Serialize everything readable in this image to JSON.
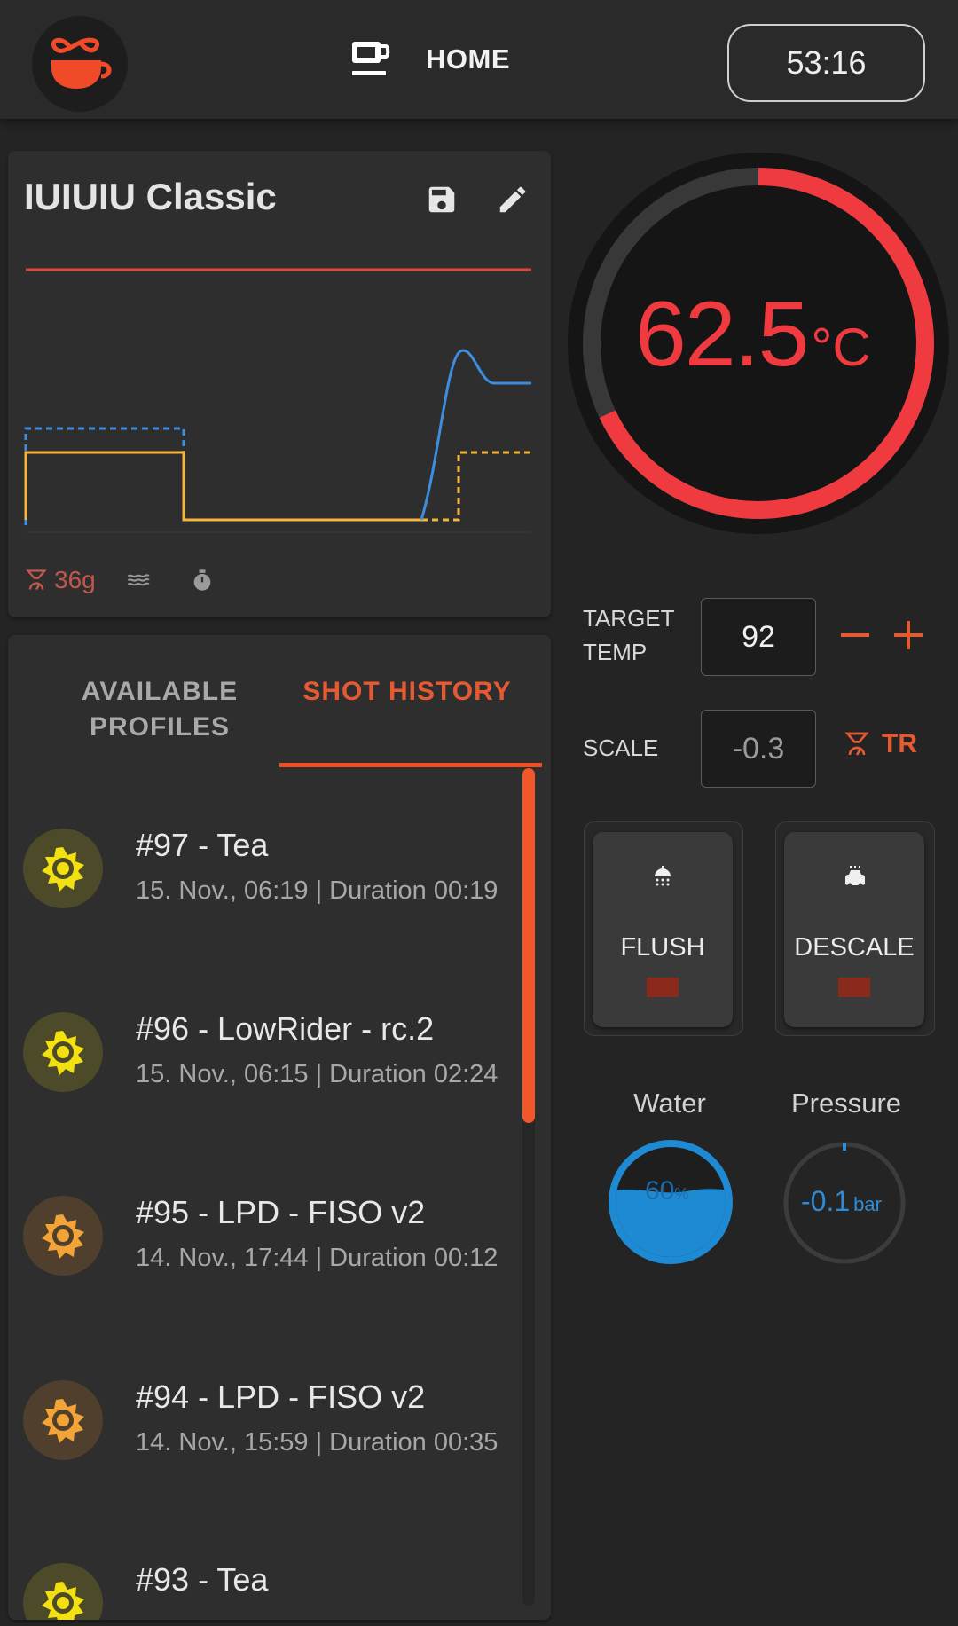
{
  "header": {
    "logo": "espresso-cup-logo",
    "nav_icon": "coffee-cup-icon",
    "nav_label": "HOME",
    "timer": "53:16"
  },
  "profile": {
    "name": "IUIUIU Classic",
    "save_icon": "save-icon",
    "edit_icon": "edit-icon",
    "stats": {
      "weight": "36g"
    },
    "colors": {
      "temp_line": "#e0443a",
      "pressure": "#f5b73b",
      "flow": "#3d8ee0"
    }
  },
  "tabs": {
    "available": "AVAILABLE PROFILES",
    "history": "SHOT HISTORY",
    "active": "history"
  },
  "shots": [
    {
      "title": "#97 - Tea",
      "subtitle": "15. Nov., 06:19 | Duration 00:19",
      "icon": "sun-icon",
      "status": "yellow"
    },
    {
      "title": "#96 - LowRider - rc.2",
      "subtitle": "15. Nov., 06:15 | Duration 02:24",
      "icon": "sun-icon",
      "status": "yellow"
    },
    {
      "title": "#95 - LPD - FISO v2",
      "subtitle": "14. Nov., 17:44 | Duration 00:12",
      "icon": "sun-icon",
      "status": "orange"
    },
    {
      "title": "#94 - LPD - FISO v2",
      "subtitle": "14. Nov., 15:59 | Duration 00:35",
      "icon": "sun-icon",
      "status": "orange"
    },
    {
      "title": "#93 - Tea",
      "subtitle": "",
      "icon": "sun-icon",
      "status": "yellow"
    }
  ],
  "temperature": {
    "value": "62.5",
    "unit": "°C",
    "fraction": 0.68,
    "color": "#ef3a40"
  },
  "target_temp": {
    "label": "TARGET TEMP",
    "label_line1": "TARGET",
    "label_line2": "TEMP",
    "value": "92"
  },
  "scale": {
    "label": "SCALE",
    "value": "-0.3",
    "tare_label": "TR"
  },
  "actions": [
    {
      "label": "FLUSH",
      "icon": "shower-icon"
    },
    {
      "label": "DESCALE",
      "icon": "descale-icon"
    }
  ],
  "water": {
    "label": "Water",
    "value": "60",
    "unit": "%",
    "level": 0.6
  },
  "pressure": {
    "label": "Pressure",
    "value": "-0.1",
    "unit": "bar"
  }
}
